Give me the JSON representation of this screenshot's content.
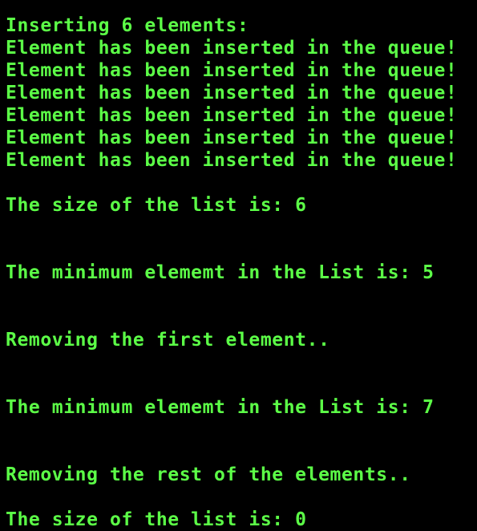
{
  "terminal": {
    "text_color": "#5cff47",
    "background_color": "#000000",
    "lines": [
      "Inserting 6 elements:",
      "Element has been inserted in the queue!",
      "Element has been inserted in the queue!",
      "Element has been inserted in the queue!",
      "Element has been inserted in the queue!",
      "Element has been inserted in the queue!",
      "Element has been inserted in the queue!",
      "",
      "The size of the list is: 6",
      "",
      "",
      "The minimum elememt in the List is: 5",
      "",
      "",
      "Removing the first element..",
      "",
      "",
      "The minimum elememt in the List is: 7",
      "",
      "",
      "Removing the rest of the elements..",
      "",
      "The size of the list is: 0"
    ]
  }
}
